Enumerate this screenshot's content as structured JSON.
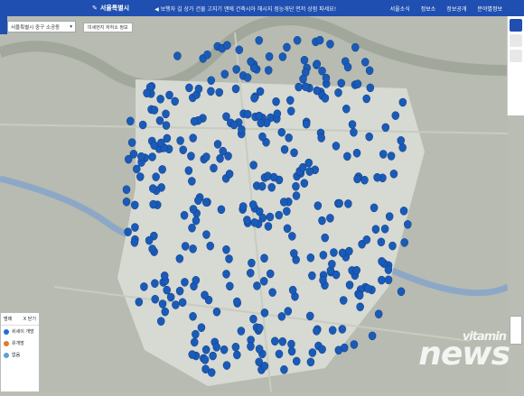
{
  "header": {
    "logo": "서울특별시",
    "notice": "◀ 보행자 길 상가 건물 고지기 앤에 건축시아 해시지 점능개단 먼저 상점 파세요!",
    "menu": [
      "서울소식",
      "정보소",
      "정보공개",
      "분야별정보"
    ]
  },
  "search": {
    "district_select": "서울특별시 중구 소공동",
    "chip": "미세먼지 저하소 정보"
  },
  "legend": {
    "title": "범례",
    "close": "X 닫기",
    "items": [
      {
        "label": "쉬세이 개방",
        "color": "#1f6fd1"
      },
      {
        "label": "유개방",
        "color": "#e07a2a"
      },
      {
        "label": "없음",
        "color": "#5aa0d8"
      }
    ]
  },
  "watermark": {
    "top": "vitamin",
    "bottom": "news"
  },
  "colors": {
    "header": "#1f4fb0",
    "marker": "#1a5bb8",
    "river": "#8ca8c6",
    "core": "#dfe1dc"
  }
}
